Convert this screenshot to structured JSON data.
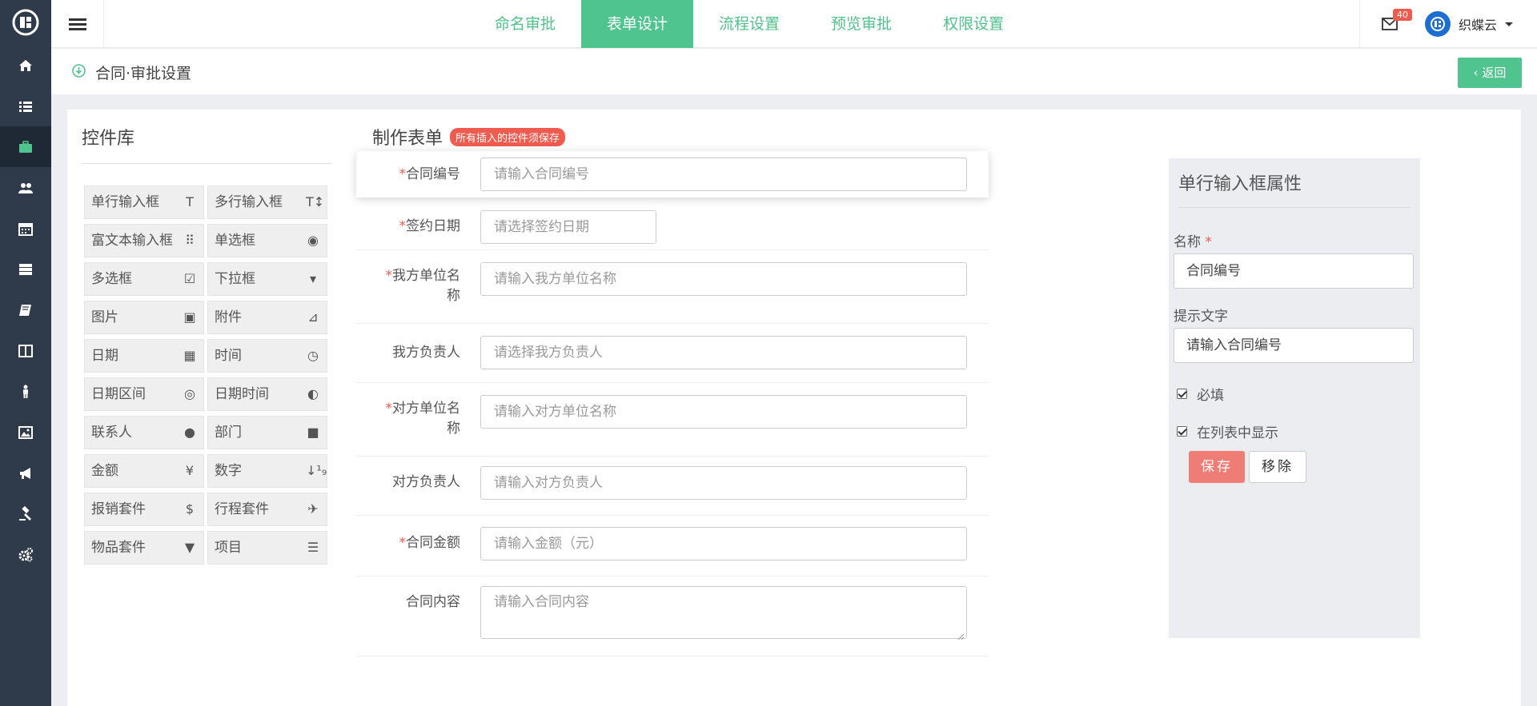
{
  "sidebar": {
    "logo": "app-logo",
    "items": [
      {
        "icon": "home-icon",
        "active": false
      },
      {
        "icon": "list-icon",
        "active": false
      },
      {
        "icon": "briefcase-icon",
        "active": true
      },
      {
        "icon": "users-icon",
        "active": false
      },
      {
        "icon": "calendar-icon",
        "active": false
      },
      {
        "icon": "server-icon",
        "active": false
      },
      {
        "icon": "book-icon",
        "active": false
      },
      {
        "icon": "columns-icon",
        "active": false
      },
      {
        "icon": "person-icon",
        "active": false
      },
      {
        "icon": "image-icon",
        "active": false
      },
      {
        "icon": "bullhorn-icon",
        "active": false
      },
      {
        "icon": "gavel-icon",
        "active": false
      },
      {
        "icon": "gears-icon",
        "active": false
      }
    ]
  },
  "header": {
    "tabs": [
      {
        "label": "命名审批",
        "active": false
      },
      {
        "label": "表单设计",
        "active": true
      },
      {
        "label": "流程设置",
        "active": false
      },
      {
        "label": "预览审批",
        "active": false
      },
      {
        "label": "权限设置",
        "active": false
      }
    ],
    "mail_count": "40",
    "user_name": "织蝶云",
    "accent": "#4fc48e"
  },
  "breadcrumb": {
    "title": "合同·审批设置",
    "back_label": "返回"
  },
  "library": {
    "title": "控件库",
    "controls": [
      {
        "label": "单行输入框",
        "icon": "text-icon",
        "glyph": "T"
      },
      {
        "label": "多行输入框",
        "icon": "text-height-icon",
        "glyph": "T↕"
      },
      {
        "label": "富文本输入框",
        "icon": "grid-icon",
        "glyph": "⠿"
      },
      {
        "label": "单选框",
        "icon": "radio-icon",
        "glyph": "◉"
      },
      {
        "label": "多选框",
        "icon": "checkbox-icon",
        "glyph": "☑"
      },
      {
        "label": "下拉框",
        "icon": "dropdown-icon",
        "glyph": "▾"
      },
      {
        "label": "图片",
        "icon": "picture-icon",
        "glyph": "▣"
      },
      {
        "label": "附件",
        "icon": "folder-icon",
        "glyph": "⊿"
      },
      {
        "label": "日期",
        "icon": "calendar-icon",
        "glyph": "▦"
      },
      {
        "label": "时间",
        "icon": "clock-icon",
        "glyph": "◷"
      },
      {
        "label": "日期区间",
        "icon": "target-icon",
        "glyph": "◎"
      },
      {
        "label": "日期时间",
        "icon": "half-circle-icon",
        "glyph": "◐"
      },
      {
        "label": "联系人",
        "icon": "user-icon",
        "glyph": "●"
      },
      {
        "label": "部门",
        "icon": "briefcase-icon",
        "glyph": "■"
      },
      {
        "label": "金额",
        "icon": "yen-icon",
        "glyph": "¥"
      },
      {
        "label": "数字",
        "icon": "sort-numeric-icon",
        "glyph": "↓¹₉"
      },
      {
        "label": "报销套件",
        "icon": "dollar-icon",
        "glyph": "$"
      },
      {
        "label": "行程套件",
        "icon": "plane-icon",
        "glyph": "✈"
      },
      {
        "label": "物品套件",
        "icon": "filter-icon",
        "glyph": "▼"
      },
      {
        "label": "项目",
        "icon": "list-icon",
        "glyph": "☰"
      }
    ]
  },
  "form": {
    "title": "制作表单",
    "tip": "所有插入的控件须保存",
    "fields": [
      {
        "label": "合同编号",
        "required": "*",
        "placeholder": "请输入合同编号"
      },
      {
        "label": "签约日期",
        "required": "*",
        "placeholder": "请选择签约日期"
      },
      {
        "label": "我方单位名称",
        "required": "*",
        "placeholder": "请输入我方单位名称"
      },
      {
        "label": "我方负责人",
        "required": "",
        "placeholder": "请选择我方负责人"
      },
      {
        "label": "对方单位名称",
        "required": "*",
        "placeholder": "请输入对方单位名称"
      },
      {
        "label": "对方负责人",
        "required": "",
        "placeholder": "请输入对方负责人"
      },
      {
        "label": "合同金额",
        "required": "*",
        "placeholder": "请输入金额（元）"
      },
      {
        "label": "合同内容",
        "required": "",
        "placeholder": "请输入合同内容"
      }
    ]
  },
  "properties": {
    "title": "单行输入框属性",
    "name_label": "名称",
    "name_required": "*",
    "name_value": "合同编号",
    "hint_label": "提示文字",
    "hint_value": "请输入合同编号",
    "required_label": "必填",
    "required_checked": true,
    "show_in_list_label": "在列表中显示",
    "show_in_list_checked": true,
    "save_label": "保存",
    "remove_label": "移除",
    "save_color": "#ef7d75"
  }
}
